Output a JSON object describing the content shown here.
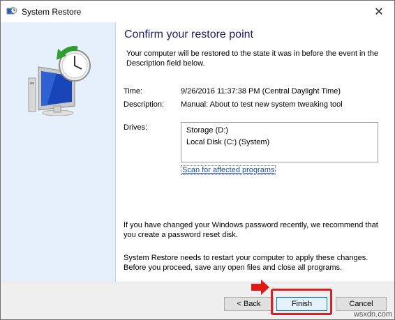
{
  "window": {
    "title": "System Restore",
    "close_glyph": "✕",
    "icon": "system-restore-icon"
  },
  "main": {
    "heading": "Confirm your restore point",
    "intro": "Your computer will be restored to the state it was in before the event in the Description field below.",
    "time_label": "Time:",
    "time_value": "9/26/2016 11:37:38 PM (Central Daylight Time)",
    "description_label": "Description:",
    "description_value": "Manual: About to test new system tweaking tool",
    "drives_label": "Drives:",
    "drives": [
      "Storage (D:)",
      "Local Disk (C:) (System)"
    ],
    "scan_link": "Scan for affected programs",
    "password_note": "If you have changed your Windows password recently, we recommend that you create a password reset disk.",
    "restart_note": "System Restore needs to restart your computer to apply these changes. Before you proceed, save any open files and close all programs."
  },
  "buttons": {
    "back": "< Back",
    "finish": "Finish",
    "cancel": "Cancel"
  },
  "annotation": {
    "highlight_color": "#d72020"
  },
  "watermark": "wsxdn.com"
}
